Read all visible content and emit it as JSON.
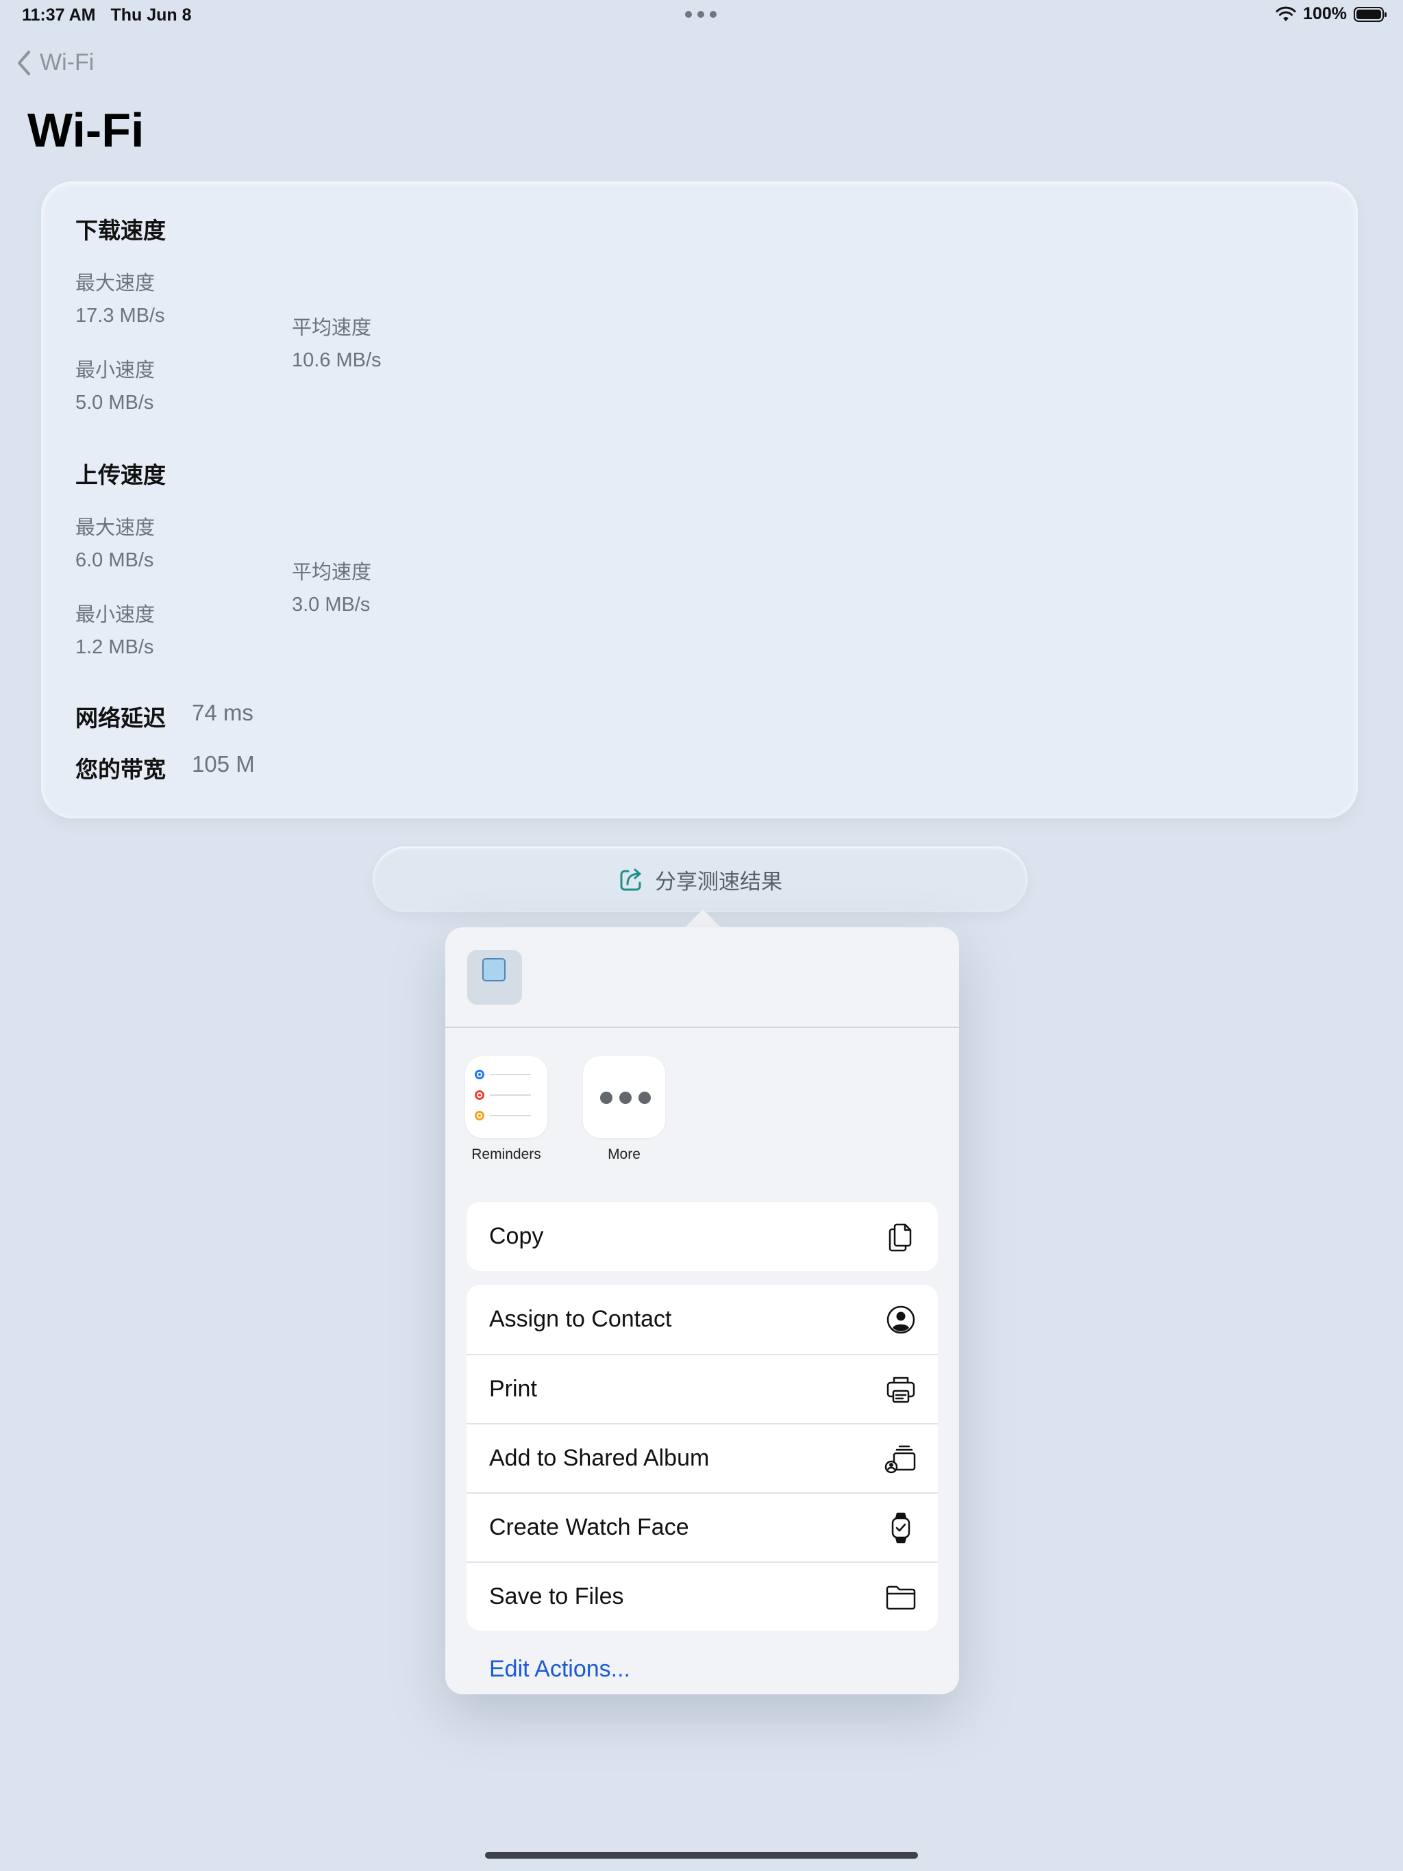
{
  "status_bar": {
    "time": "11:37 AM",
    "date": "Thu Jun 8",
    "battery": "100%"
  },
  "nav": {
    "back_label": "Wi-Fi",
    "title": "Wi-Fi"
  },
  "speed_card": {
    "download": {
      "title": "下载速度",
      "max_label": "最大速度",
      "max_value": "17.3 MB/s",
      "min_label": "最小速度",
      "min_value": "5.0 MB/s",
      "avg_label": "平均速度",
      "avg_value": "10.6 MB/s"
    },
    "upload": {
      "title": "上传速度",
      "max_label": "最大速度",
      "max_value": "6.0 MB/s",
      "min_label": "最小速度",
      "min_value": "1.2 MB/s",
      "avg_label": "平均速度",
      "avg_value": "3.0 MB/s"
    },
    "latency_label": "网络延迟",
    "latency_value": "74 ms",
    "bandwidth_label": "您的带宽",
    "bandwidth_value": "105 M"
  },
  "share_button": {
    "label": "分享测速结果",
    "icon": "share-icon",
    "icon_color": "#1f8f8a"
  },
  "share_sheet": {
    "apps": [
      {
        "label": "Reminders",
        "icon": "reminders-icon"
      },
      {
        "label": "More",
        "icon": "more-icon"
      }
    ],
    "copy_group": [
      {
        "label": "Copy",
        "icon": "copy-icon"
      }
    ],
    "actions": [
      {
        "label": "Assign to Contact",
        "icon": "contact-icon"
      },
      {
        "label": "Print",
        "icon": "printer-icon"
      },
      {
        "label": "Add to Shared Album",
        "icon": "shared-album-icon"
      },
      {
        "label": "Create Watch Face",
        "icon": "watch-icon"
      },
      {
        "label": "Save to Files",
        "icon": "folder-icon"
      }
    ],
    "edit_actions": "Edit Actions..."
  },
  "colors": {
    "background": "#dbe4ee",
    "card": "#e6edf6",
    "link": "#1c5bd6",
    "reminder_blue": "#1e7cf2",
    "reminder_red": "#ea4335",
    "reminder_orange": "#f2a51b"
  }
}
